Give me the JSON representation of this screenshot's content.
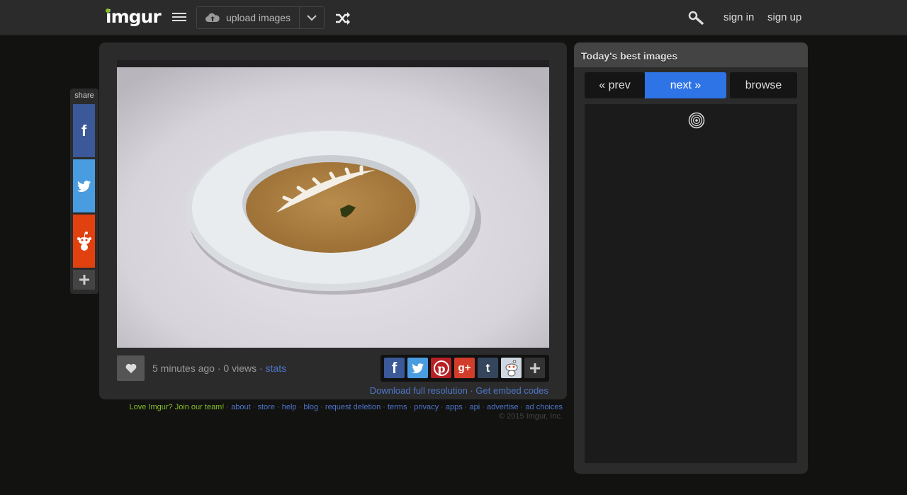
{
  "brand": {
    "logo_text": "imgur",
    "accent": "#85bf25"
  },
  "topbar": {
    "upload_label": "upload images",
    "sign_in": "sign in",
    "sign_up": "sign up"
  },
  "sharebar": {
    "label": "share",
    "items": [
      {
        "name": "facebook",
        "icon": "facebook-icon",
        "color": "#3b5998"
      },
      {
        "name": "twitter",
        "icon": "twitter-icon",
        "color": "#4a9ce0"
      },
      {
        "name": "reddit",
        "icon": "reddit-icon",
        "color": "#e0410f"
      }
    ]
  },
  "post": {
    "timestamp": "5 minutes ago",
    "views": "0 views",
    "stats_label": "stats",
    "separator": " · ",
    "download_label": "Download full resolution",
    "embed_label": "Get embed codes",
    "social": [
      "facebook",
      "twitter",
      "pinterest",
      "google-plus",
      "tumblr",
      "reddit",
      "more"
    ]
  },
  "footer": {
    "join": "Love Imgur? Join our team!",
    "links": [
      "about",
      "store",
      "help",
      "blog",
      "request deletion",
      "terms",
      "privacy",
      "apps",
      "api",
      "advertise",
      "ad choices"
    ],
    "copyright": "© 2015 Imgur, Inc."
  },
  "sidebar": {
    "title": "Today's best images",
    "prev_label": "« prev",
    "next_label": "next »",
    "browse_label": "browse",
    "active_color": "#2e74e6"
  }
}
